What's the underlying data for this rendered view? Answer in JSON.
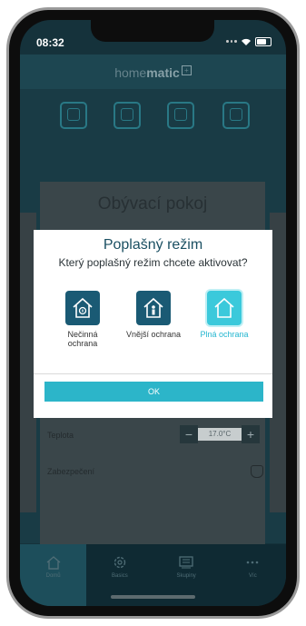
{
  "status_bar": {
    "time": "08:32"
  },
  "brand": {
    "name_light": "home",
    "name_bold": "matic",
    "mark": "+"
  },
  "room": {
    "title": "Obývací pokoj",
    "rows": {
      "temperature_label": "Teplota",
      "temperature_value": "17.0°C",
      "security_label": "Zabezpečení"
    }
  },
  "dialog": {
    "title": "Poplašný režim",
    "question": "Který poplašný režim chcete aktivovat?",
    "modes": [
      {
        "label": "Nečinná ochrana",
        "icon": "house-idle-icon",
        "selected": false
      },
      {
        "label": "Vnější ochrana",
        "icon": "house-person-icon",
        "selected": false
      },
      {
        "label": "Plná ochrana",
        "icon": "house-full-icon",
        "selected": true
      }
    ],
    "ok_label": "OK"
  },
  "tabbar": [
    {
      "label": "Domů",
      "icon": "home-icon",
      "active": true
    },
    {
      "label": "Basics",
      "icon": "gear-icon",
      "active": false
    },
    {
      "label": "Skupiny",
      "icon": "list-icon",
      "active": false
    },
    {
      "label": "Víc",
      "icon": "more-icon",
      "active": false
    }
  ],
  "colors": {
    "accent": "#2cb5c9",
    "mode_icon": "#1a5a74",
    "selected_mode": "#3bc9db",
    "dialog_title": "#1a4f62"
  }
}
